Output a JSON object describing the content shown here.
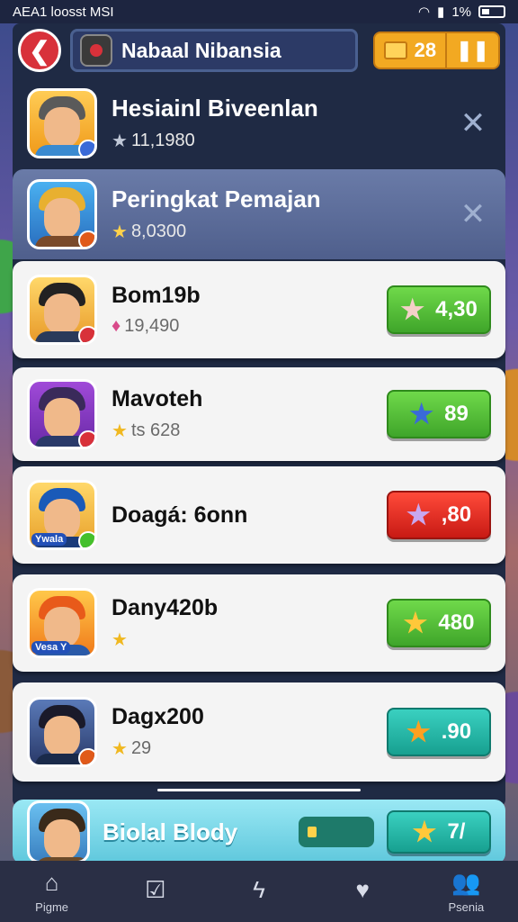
{
  "status_bar": {
    "left": "AEA1 loosst  MSI",
    "battery": "1%"
  },
  "header": {
    "title": "Nabaal Nibansia",
    "coins": "28"
  },
  "rows": [
    {
      "name": "Hesiainl Biveenlan",
      "sub": "11,1980",
      "star": "★"
    },
    {
      "name": "Peringkat Pemajan",
      "sub": "8,0300",
      "star": "★"
    },
    {
      "name": "Bom19b",
      "sub": "19,490",
      "star": "♦",
      "score": "4,30",
      "color": "#44c02c"
    },
    {
      "name": "Mavoteh",
      "sub": "ts 628",
      "star": "★",
      "score": "89",
      "color": "#44c02c"
    },
    {
      "name": "Doagá: 6onn",
      "score": ",80",
      "color": "#dd2a20",
      "pill": "Ywala"
    },
    {
      "name": "Dany420b",
      "star": "★",
      "score": "480",
      "color": "#44c02c",
      "pill": "Vesa  Y"
    },
    {
      "name": "Dagx200",
      "sub": "29",
      "star": "★",
      "score": ".90",
      "color": "#1fb4a4"
    }
  ],
  "bottom_card": {
    "name": "Biolal Blody",
    "score": "7/"
  },
  "nav": [
    {
      "label": "Pigme",
      "icon": "home-icon"
    },
    {
      "label": "",
      "icon": "check-icon"
    },
    {
      "label": "",
      "icon": "lightning-icon"
    },
    {
      "label": "",
      "icon": "heart-icon"
    },
    {
      "label": "Psenia",
      "icon": "people-icon"
    }
  ]
}
